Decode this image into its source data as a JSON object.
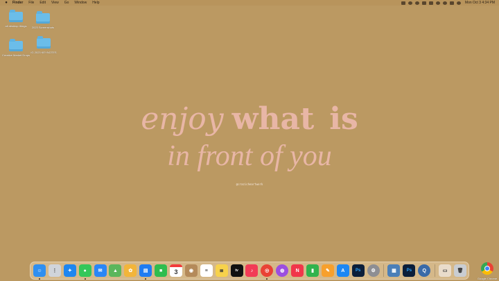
{
  "menubar": {
    "app_name": "Finder",
    "items": [
      "File",
      "Edit",
      "View",
      "Go",
      "Window",
      "Help"
    ],
    "clock": "Mon Oct 3 4:34 PM"
  },
  "desktop": {
    "icons": [
      {
        "label": "all desktop things"
      },
      {
        "label": "2023 Screenshots"
      },
      {
        "label": "Creative Market Drops"
      },
      {
        "label": "IG 2023 KEYNOTES"
      }
    ],
    "corner_app": {
      "label": "Google Chrome"
    }
  },
  "wallpaper": {
    "line1_part1": "enjoy",
    "line1_part2": "what",
    "line1_part3": "is",
    "line2": "in front of you",
    "handle": "@crazicheartwork",
    "text_color": "#e8b6a6",
    "background_color": "#bb9962"
  },
  "dock": {
    "apps": [
      {
        "name": "finder-icon",
        "color": "#2f8ff0",
        "glyph": "☺"
      },
      {
        "name": "launchpad-icon",
        "color": "#d0d4da",
        "glyph": "⋮"
      },
      {
        "name": "safari-icon",
        "color": "#1e86f0",
        "glyph": "✦"
      },
      {
        "name": "messages-icon",
        "color": "#34c759",
        "glyph": "●"
      },
      {
        "name": "mail-icon",
        "color": "#2a86f6",
        "glyph": "✉"
      },
      {
        "name": "maps-icon",
        "color": "#5bb65c",
        "glyph": "▲"
      },
      {
        "name": "photos-icon",
        "color": "#f2b53a",
        "glyph": "✿"
      },
      {
        "name": "keynote-icon",
        "color": "#1f7cf2",
        "glyph": "▤"
      },
      {
        "name": "facetime-icon",
        "color": "#2fbd4e",
        "glyph": "■"
      },
      {
        "name": "calendar-icon",
        "color": "#ffffff",
        "glyph": "3"
      },
      {
        "name": "contacts-icon",
        "color": "#b48a5a",
        "glyph": "◉"
      },
      {
        "name": "reminders-icon",
        "color": "#ffffff",
        "glyph": "≡"
      },
      {
        "name": "notes-icon",
        "color": "#f7d24b",
        "glyph": "≣"
      },
      {
        "name": "apple-tv-icon",
        "color": "#111111",
        "glyph": "tv"
      },
      {
        "name": "music-icon",
        "color": "#f23b56",
        "glyph": "♪"
      },
      {
        "name": "chrome-icon",
        "color": "#e94235",
        "glyph": "◎"
      },
      {
        "name": "podcasts-icon",
        "color": "#9c4ee0",
        "glyph": "◍"
      },
      {
        "name": "news-icon",
        "color": "#f1364a",
        "glyph": "N"
      },
      {
        "name": "numbers-icon",
        "color": "#31b34d",
        "glyph": "▮"
      },
      {
        "name": "pages-icon",
        "color": "#f7a02c",
        "glyph": "✎"
      },
      {
        "name": "app-store-icon",
        "color": "#1c87f4",
        "glyph": "A"
      },
      {
        "name": "photoshop-icon",
        "color": "#0b1e3a",
        "glyph": "Ps"
      },
      {
        "name": "system-preferences-icon",
        "color": "#8e8e93",
        "glyph": "⚙"
      }
    ],
    "trailing_apps": [
      {
        "name": "preview-icon",
        "color": "#4b7fb8",
        "glyph": "▦"
      },
      {
        "name": "photoshop-icon-2",
        "color": "#0b1e3a",
        "glyph": "Ps"
      },
      {
        "name": "quicktime-icon",
        "color": "#3a6aa8",
        "glyph": "Q"
      }
    ],
    "end_items": [
      {
        "name": "downloads-stack-icon",
        "color": "#e9dccb",
        "glyph": "▭"
      },
      {
        "name": "trash-icon",
        "color": "#c9cdd2",
        "glyph": "🗑"
      }
    ]
  }
}
